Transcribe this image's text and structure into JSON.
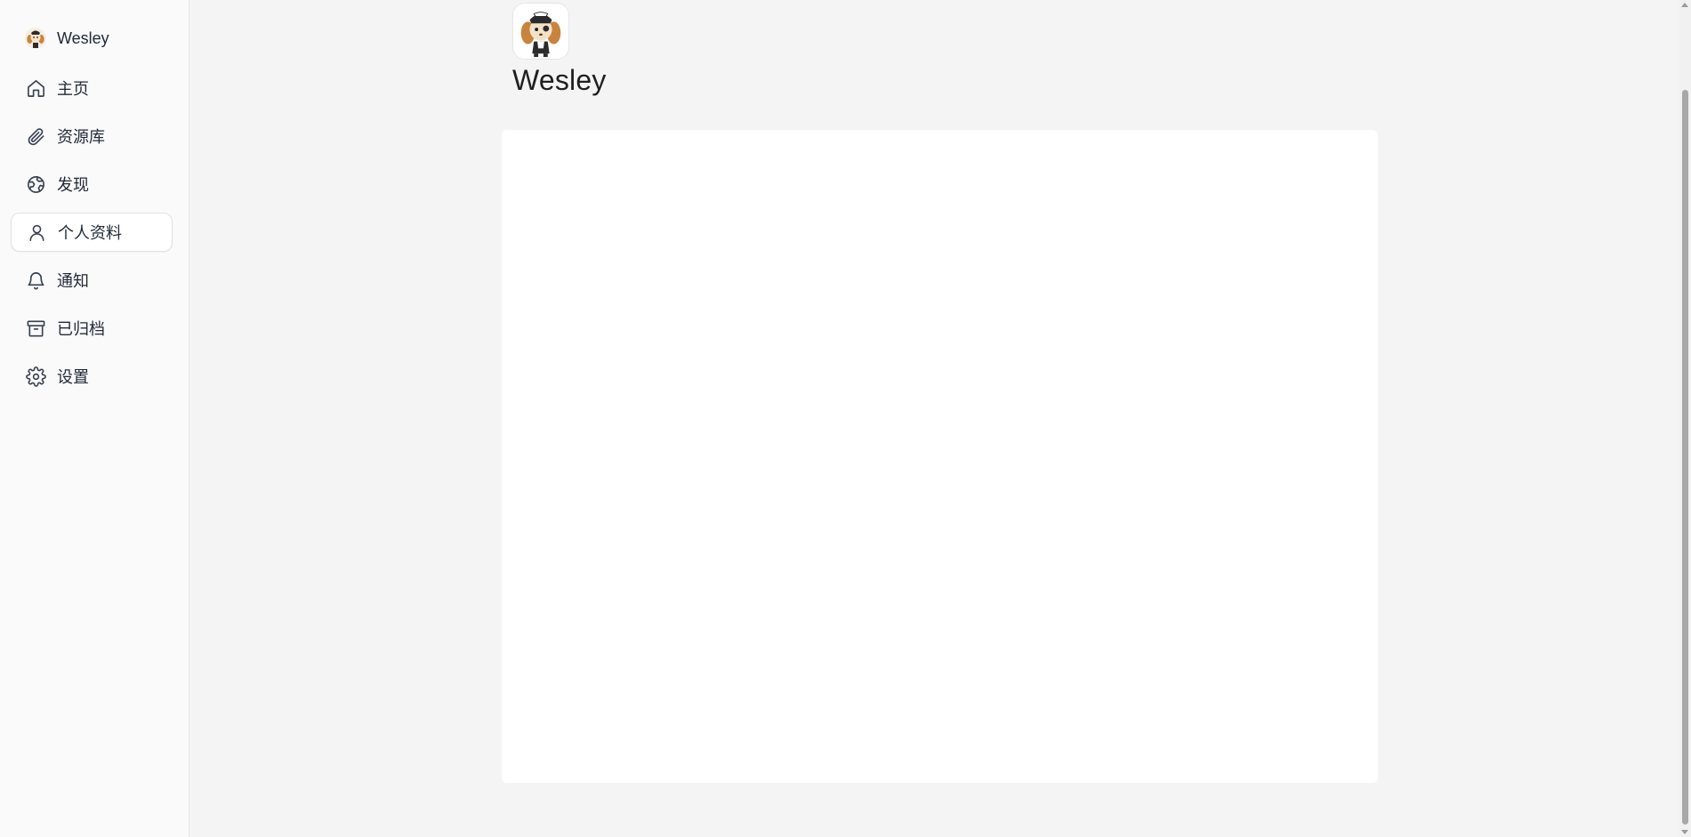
{
  "sidebar": {
    "user": {
      "name": "Wesley",
      "avatar_icon": "dog-avatar-icon"
    },
    "items": [
      {
        "label": "主页",
        "icon": "home-icon"
      },
      {
        "label": "资源库",
        "icon": "paperclip-icon"
      },
      {
        "label": "发现",
        "icon": "globe-icon"
      },
      {
        "label": "个人资料",
        "icon": "user-icon",
        "active": true
      },
      {
        "label": "通知",
        "icon": "bell-icon"
      },
      {
        "label": "已归档",
        "icon": "archive-icon"
      },
      {
        "label": "设置",
        "icon": "gear-icon"
      }
    ]
  },
  "profile": {
    "name": "Wesley",
    "avatar_icon": "dog-avatar-icon"
  },
  "colors": {
    "page_background": "#f4f4f4",
    "sidebar_background": "#fafafa",
    "card_background": "#ffffff",
    "active_item_background": "#ffffff"
  }
}
